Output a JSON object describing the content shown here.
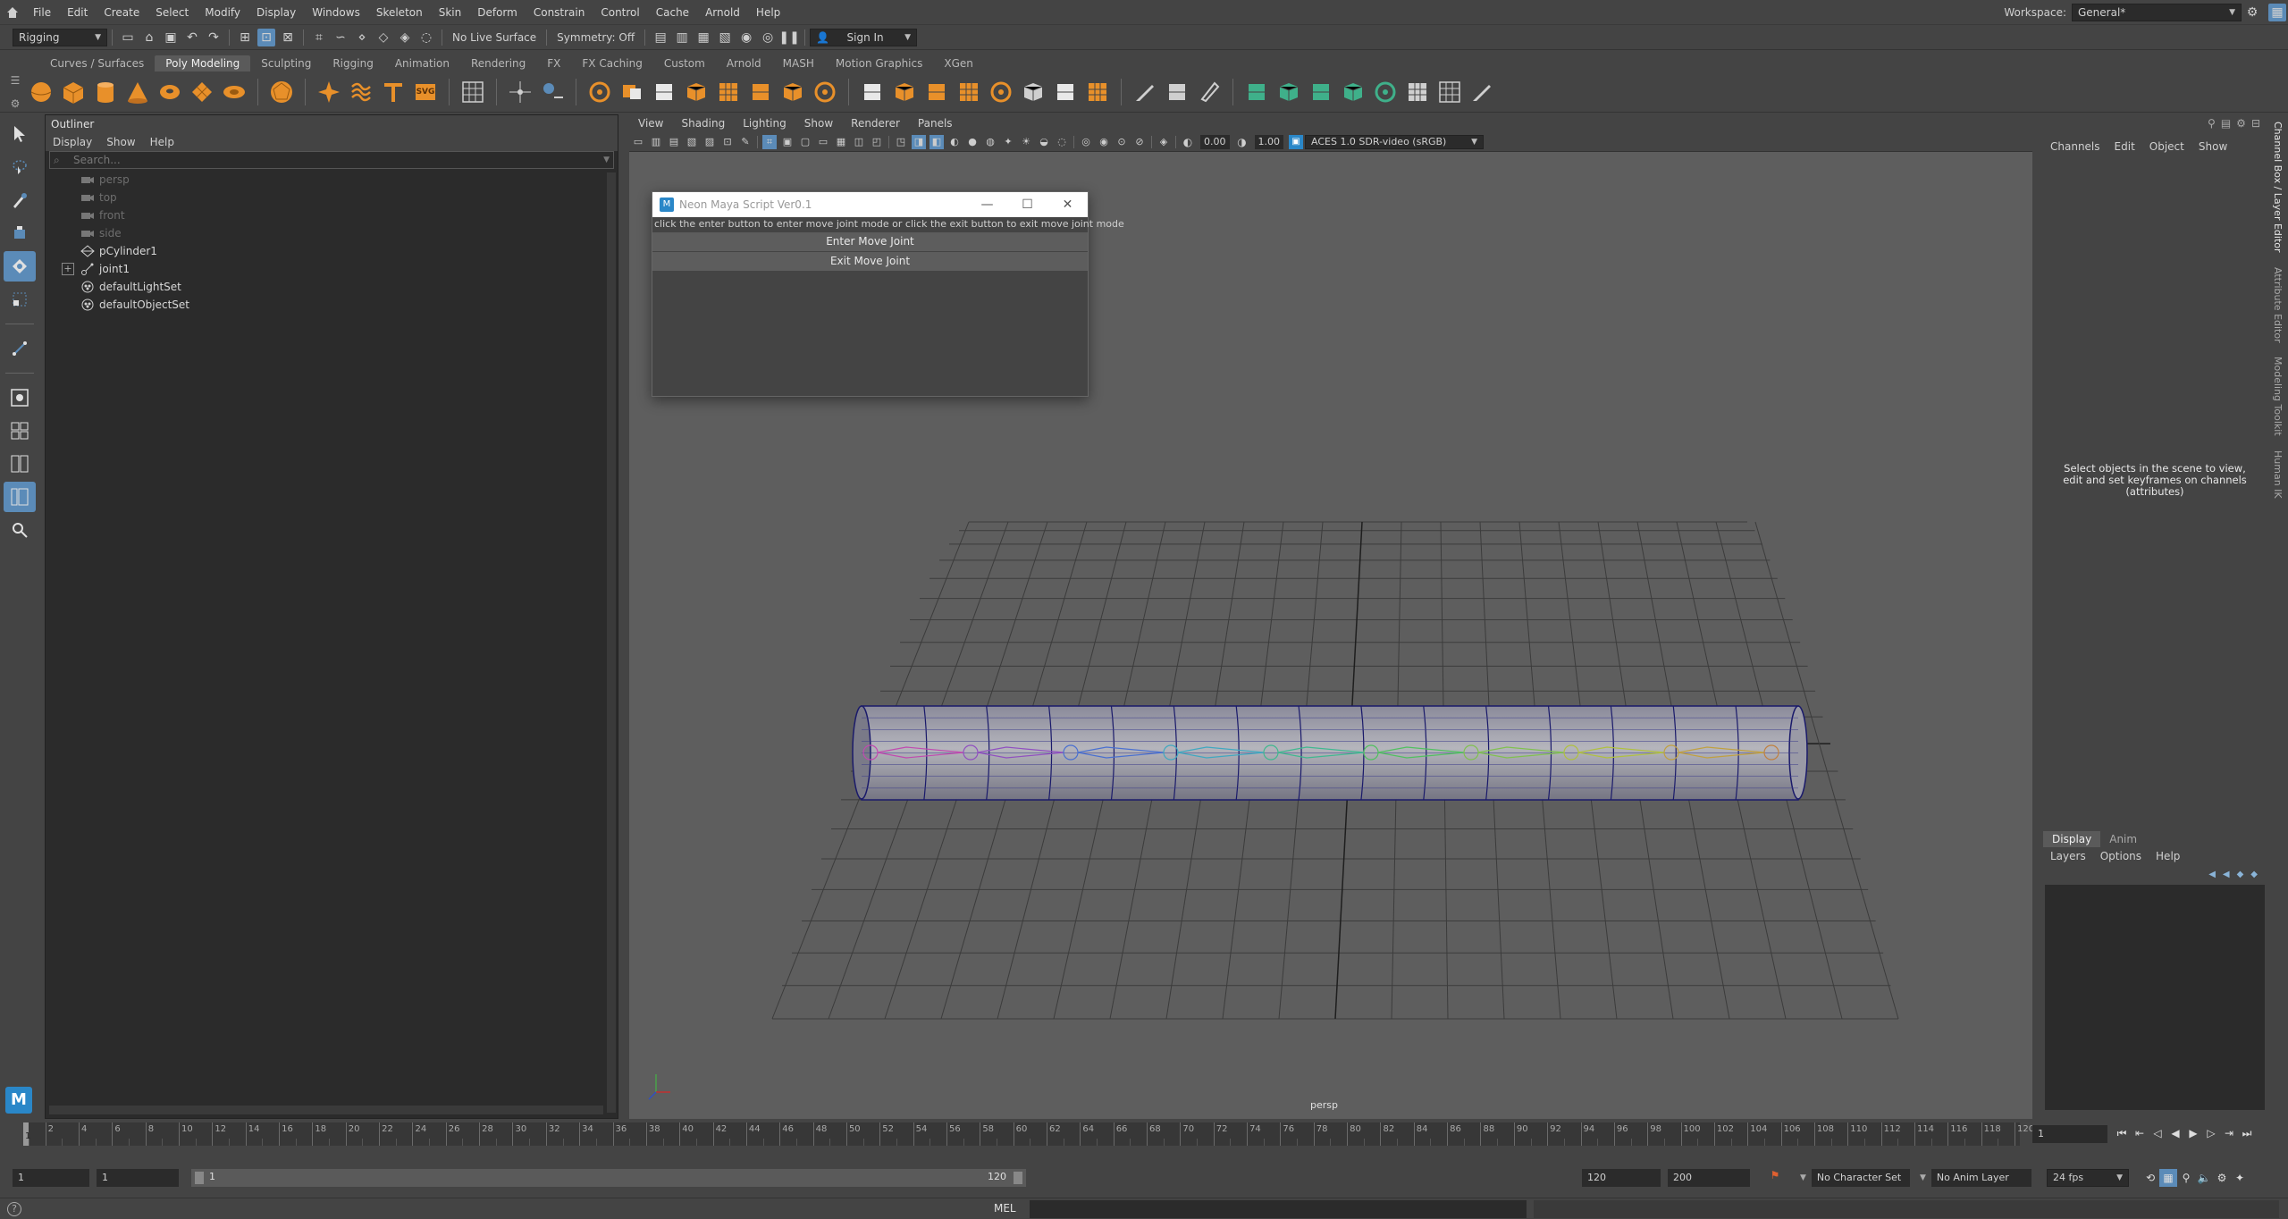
{
  "menubar": {
    "items": [
      "File",
      "Edit",
      "Create",
      "Select",
      "Modify",
      "Display",
      "Windows",
      "Skeleton",
      "Skin",
      "Deform",
      "Constrain",
      "Control",
      "Cache",
      "Arnold",
      "Help"
    ],
    "workspace_label": "Workspace:",
    "workspace_value": "General*"
  },
  "statusline": {
    "mode": "Rigging",
    "live_surface": "No Live Surface",
    "symmetry": "Symmetry: Off",
    "sign_in": "Sign In"
  },
  "shelf": {
    "tabs": [
      "Curves / Surfaces",
      "Poly Modeling",
      "Sculpting",
      "Rigging",
      "Animation",
      "Rendering",
      "FX",
      "FX Caching",
      "Custom",
      "Arnold",
      "MASH",
      "Motion Graphics",
      "XGen"
    ],
    "active_tab": "Poly Modeling",
    "svg_label": "SVG"
  },
  "outliner": {
    "title": "Outliner",
    "menus": [
      "Display",
      "Show",
      "Help"
    ],
    "search_placeholder": "Search...",
    "items": [
      {
        "label": "persp",
        "dim": true
      },
      {
        "label": "top",
        "dim": true
      },
      {
        "label": "front",
        "dim": true
      },
      {
        "label": "side",
        "dim": true
      },
      {
        "label": "pCylinder1",
        "dim": false
      },
      {
        "label": "joint1",
        "dim": false
      },
      {
        "label": "defaultLightSet",
        "dim": false
      },
      {
        "label": "defaultObjectSet",
        "dim": false
      }
    ]
  },
  "viewport": {
    "menus": [
      "View",
      "Shading",
      "Lighting",
      "Show",
      "Renderer",
      "Panels"
    ],
    "exposure": "0.00",
    "gamma": "1.00",
    "color_space": "ACES 1.0 SDR-video (sRGB)",
    "camera_label": "persp"
  },
  "script_window": {
    "title": "Neon Maya Script Ver0.1",
    "hint": "click the enter button to enter move joint mode or click the exit button to exit move joint mode",
    "enter_button": "Enter Move Joint",
    "exit_button": "Exit Move Joint"
  },
  "channel_box": {
    "menus": [
      "Channels",
      "Edit",
      "Object",
      "Show"
    ],
    "message_line1": "Select objects in the scene to view,",
    "message_line2": "edit and set keyframes on channels",
    "message_line3": "(attributes)"
  },
  "layer_editor": {
    "tabs": [
      "Display",
      "Anim"
    ],
    "menus": [
      "Layers",
      "Options",
      "Help"
    ]
  },
  "side_tabs": [
    "Channel Box / Layer Editor",
    "Attribute Editor",
    "Modeling Toolkit",
    "Human IK"
  ],
  "time_slider": {
    "tick_labels": [
      "2",
      "4",
      "6",
      "8",
      "10",
      "12",
      "14",
      "16",
      "18",
      "20",
      "22",
      "24",
      "26",
      "28",
      "30",
      "32",
      "34",
      "36",
      "38",
      "40",
      "42",
      "44",
      "46",
      "48",
      "50",
      "52",
      "54",
      "56",
      "58",
      "60",
      "62",
      "64",
      "66",
      "68",
      "70",
      "72",
      "74",
      "76",
      "78",
      "80",
      "82",
      "84",
      "86",
      "88",
      "90",
      "92",
      "94",
      "96",
      "98",
      "100",
      "102",
      "104",
      "106",
      "108",
      "110",
      "112",
      "114",
      "116",
      "118",
      "120"
    ],
    "current_frame": "1",
    "current_field": "1"
  },
  "range_slider": {
    "start": "1",
    "playback_start": "1",
    "range_start_label": "1",
    "range_end_label": "120",
    "playback_end": "120",
    "end": "200",
    "character_set": "No Character Set",
    "anim_layer": "No Anim Layer",
    "fps": "24 fps"
  },
  "command_line": {
    "language": "MEL"
  },
  "colors": {
    "accent_blue": "#5b8bb8",
    "shelf_orange": "#e8902a",
    "shelf_green": "#3fb08a"
  }
}
